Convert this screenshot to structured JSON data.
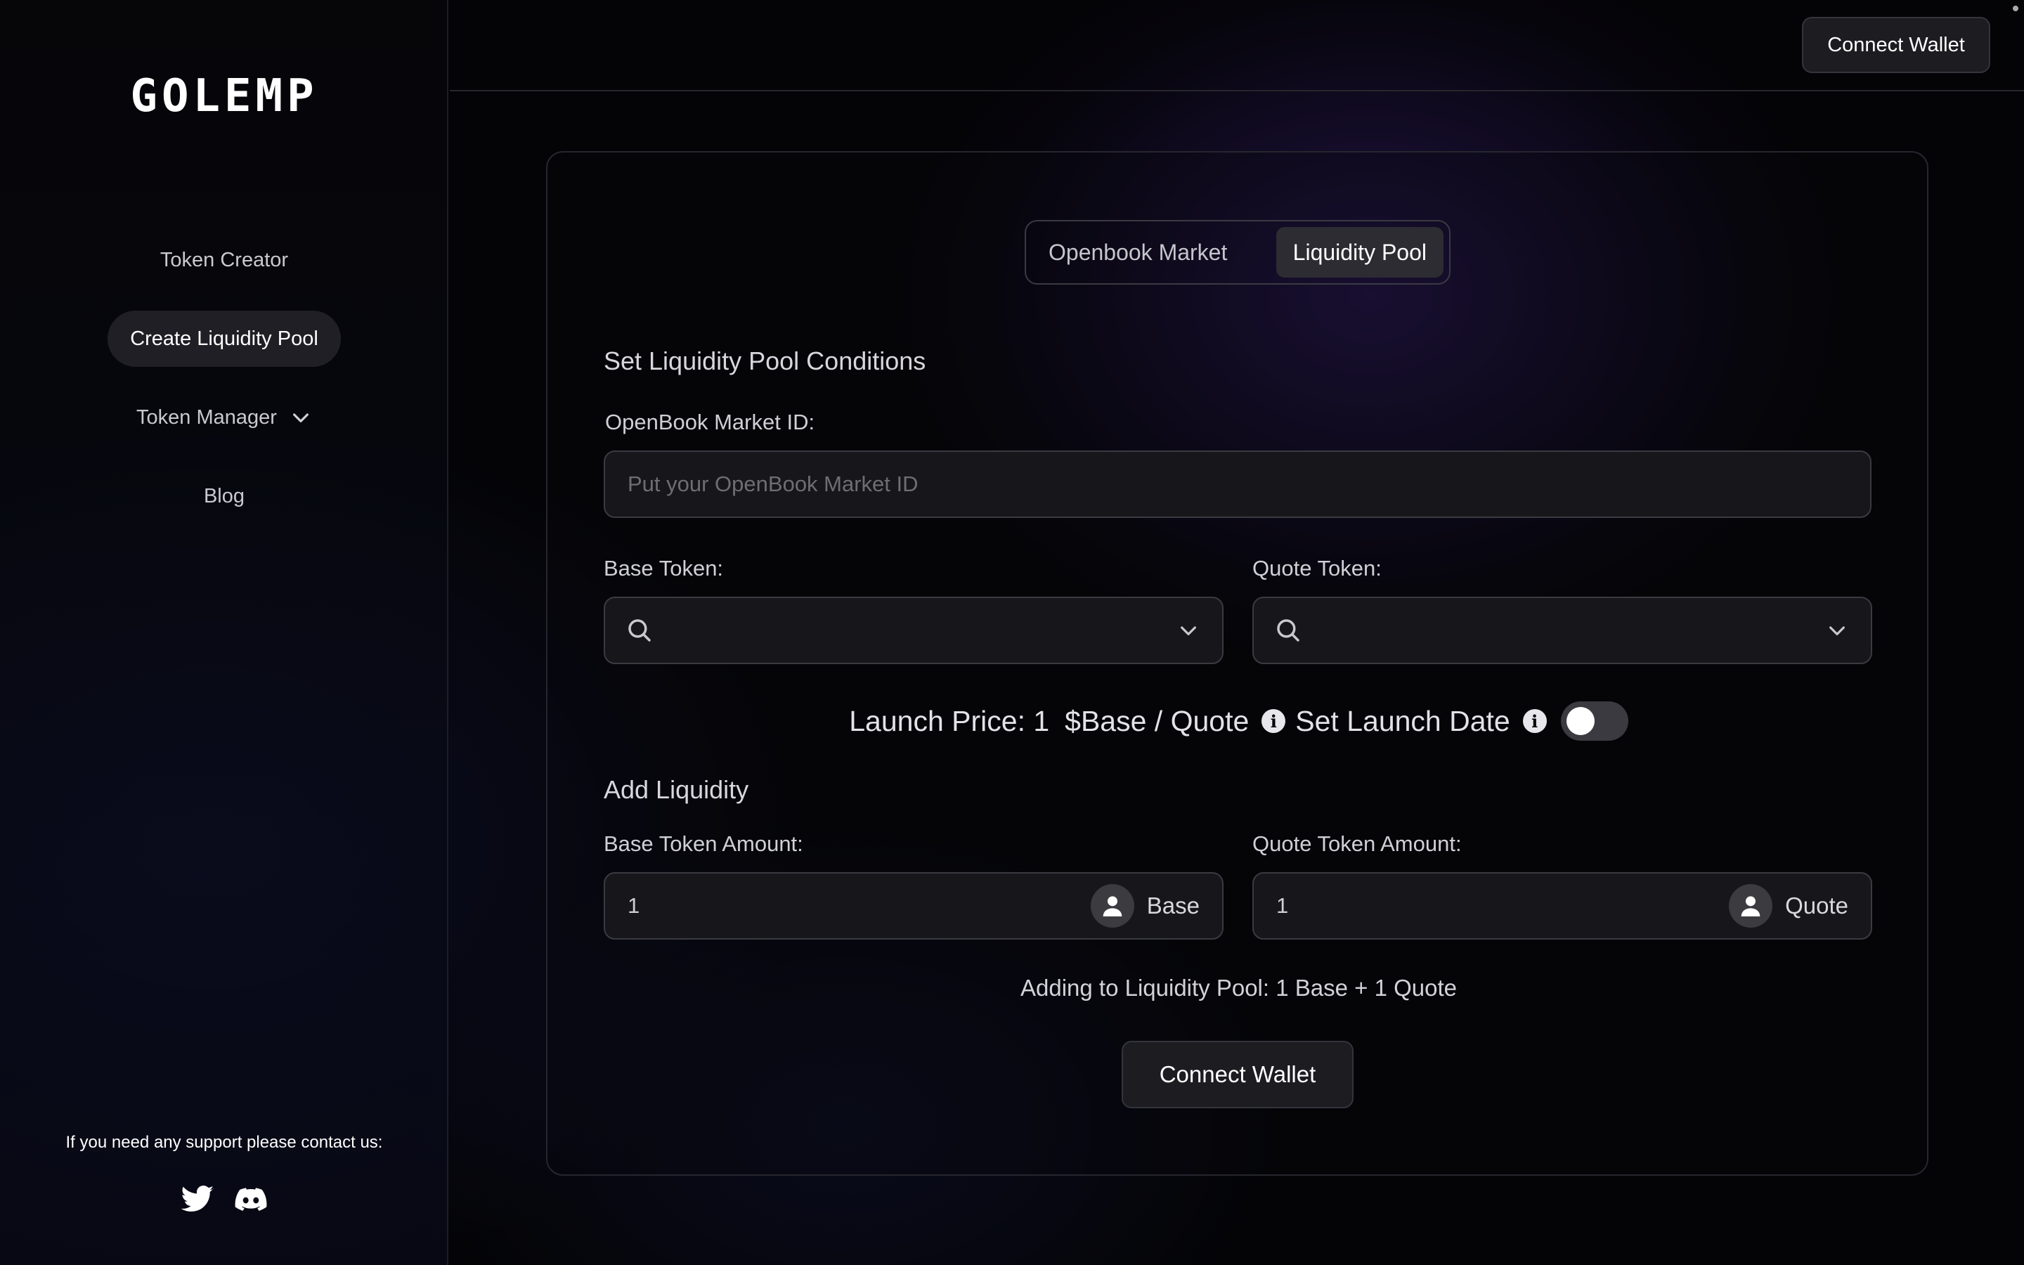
{
  "sidebar": {
    "logo": "GOLEMP",
    "items": [
      {
        "label": "Token Creator"
      },
      {
        "label": "Create Liquidity Pool"
      },
      {
        "label": "Token Manager"
      },
      {
        "label": "Blog"
      }
    ],
    "support_text": "If you need any support please contact us:"
  },
  "header": {
    "connect_label": "Connect Wallet"
  },
  "tabs": [
    {
      "label": "Openbook Market"
    },
    {
      "label": "Liquidity Pool"
    }
  ],
  "form": {
    "section_title": "Set Liquidity Pool Conditions",
    "market_id_label": "OpenBook Market ID:",
    "market_id_placeholder": "Put your OpenBook Market ID",
    "base_token_label": "Base Token:",
    "quote_token_label": "Quote Token:",
    "launch_price_label": "Launch Price: 1",
    "launch_price_unit": "$Base / Quote",
    "launch_date_label": "Set Launch Date",
    "add_liquidity_title": "Add Liquidity",
    "base_amount_label": "Base Token Amount:",
    "base_amount_value": "1",
    "base_amount_unit": "Base",
    "quote_amount_label": "Quote Token Amount:",
    "quote_amount_value": "1",
    "quote_amount_unit": "Quote",
    "summary": "Adding to Liquidity Pool: 1 Base + 1 Quote",
    "connect_label": "Connect Wallet"
  },
  "colors": {
    "background": "#040406",
    "accent_purple": "#3a2078",
    "button_bg": "#1c1c21"
  }
}
